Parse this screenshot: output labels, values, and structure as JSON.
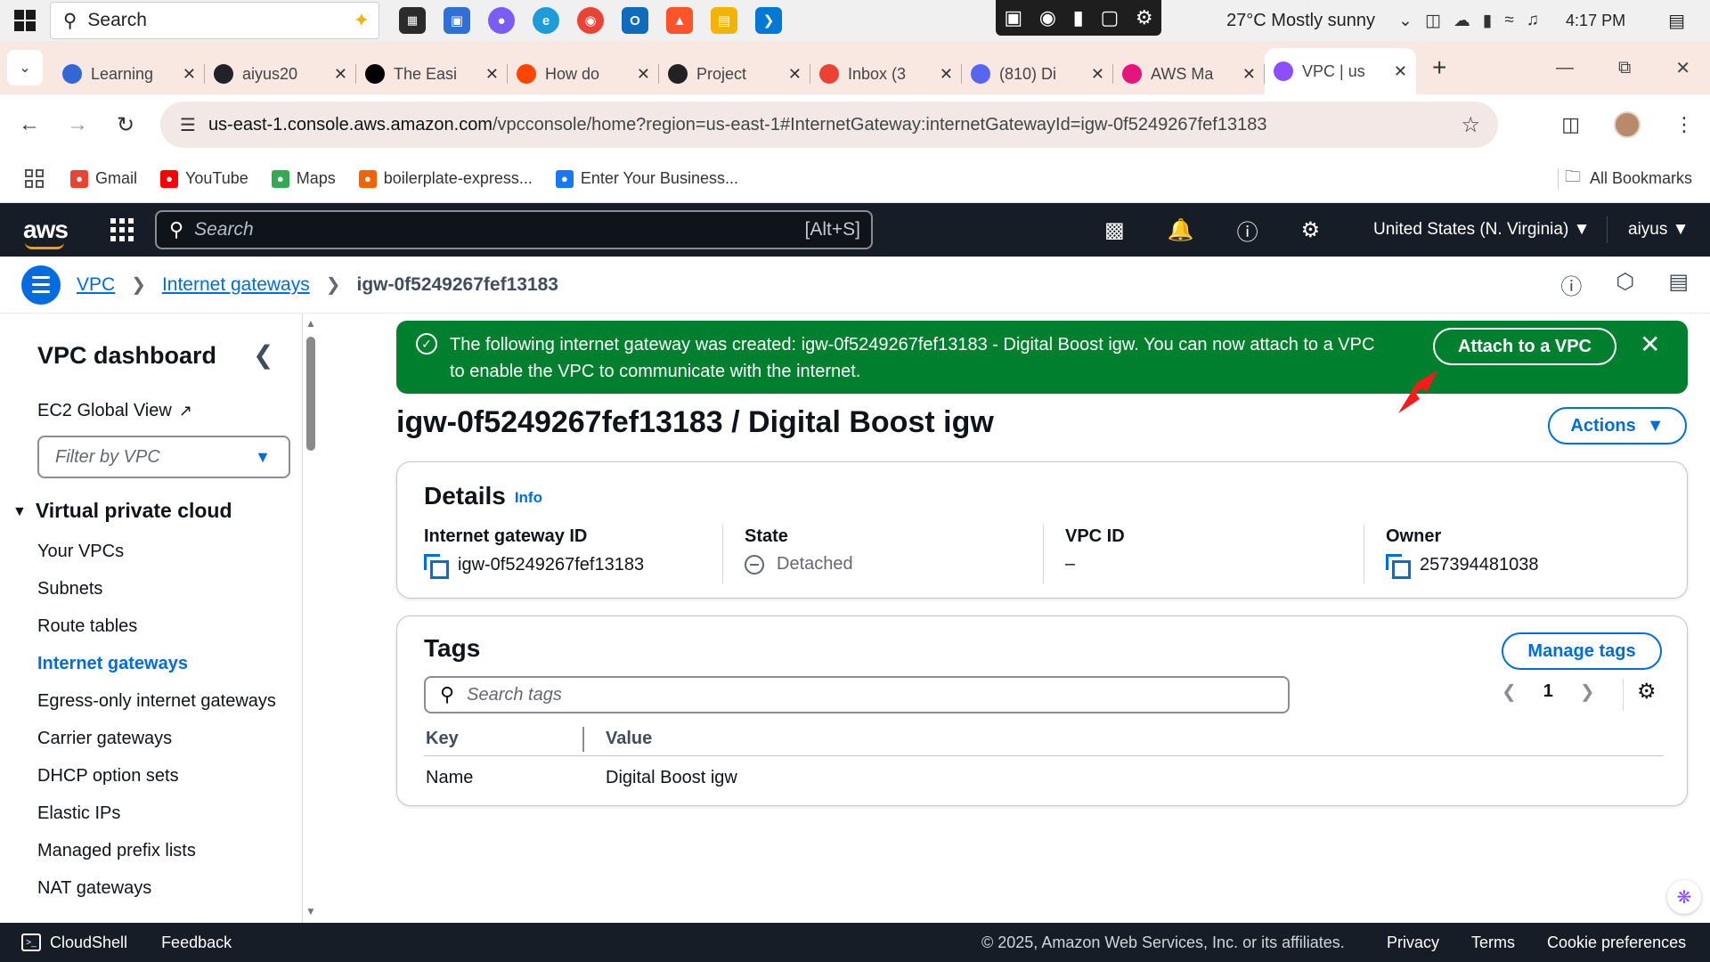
{
  "taskbar": {
    "search_placeholder": "Search",
    "weather": "27°C  Mostly sunny",
    "time": "4:17 PM"
  },
  "tabs": [
    {
      "label": "Learning",
      "icon": "learning-icon",
      "color": "#3367d6"
    },
    {
      "label": "aiyus20",
      "icon": "github-icon",
      "color": "#1f2328"
    },
    {
      "label": "The Easi",
      "icon": "medium-icon",
      "color": "#000000"
    },
    {
      "label": "How do",
      "icon": "reddit-icon",
      "color": "#ff4500"
    },
    {
      "label": "Project",
      "icon": "openai-icon",
      "color": "#222222"
    },
    {
      "label": "Inbox (3",
      "icon": "gmail-icon",
      "color": "#ea4335"
    },
    {
      "label": "(810) Di",
      "icon": "discord-icon",
      "color": "#5865f2"
    },
    {
      "label": "AWS Ma",
      "icon": "aws-cube-icon",
      "color": "#e7157b"
    },
    {
      "label": "VPC | us",
      "icon": "vpc-icon",
      "color": "#8c4fff",
      "active": true
    }
  ],
  "address": {
    "host": "us-east-1.console.aws.amazon.com",
    "path": "/vpcconsole/home?region=us-east-1#InternetGateway:internetGatewayId=igw-0f5249267fef13183"
  },
  "bookmarks": [
    {
      "label": "Gmail",
      "icon": "gmail-icon",
      "color": "#ea4335"
    },
    {
      "label": "YouTube",
      "icon": "youtube-icon",
      "color": "#ff0000"
    },
    {
      "label": "Maps",
      "icon": "maps-icon",
      "color": "#34a853"
    },
    {
      "label": "boilerplate-express...",
      "icon": "replit-icon",
      "color": "#f26207"
    },
    {
      "label": "Enter Your Business...",
      "icon": "butterfly-icon",
      "color": "#1877f2"
    }
  ],
  "bookmarks_all": "All Bookmarks",
  "aws": {
    "search_placeholder": "Search",
    "search_shortcut": "[Alt+S]",
    "region": "United States (N. Virginia) ▼",
    "user": "aiyus ▼"
  },
  "breadcrumb": {
    "vpc": "VPC",
    "igws": "Internet gateways",
    "current": "igw-0f5249267fef13183"
  },
  "sidebar": {
    "title": "VPC dashboard",
    "ec2_global": "EC2 Global View",
    "filter_placeholder": "Filter by VPC",
    "section": "Virtual private cloud",
    "items": [
      {
        "label": "Your VPCs"
      },
      {
        "label": "Subnets"
      },
      {
        "label": "Route tables"
      },
      {
        "label": "Internet gateways",
        "active": true
      },
      {
        "label": "Egress-only internet gateways"
      },
      {
        "label": "Carrier gateways"
      },
      {
        "label": "DHCP option sets"
      },
      {
        "label": "Elastic IPs"
      },
      {
        "label": "Managed prefix lists"
      },
      {
        "label": "NAT gateways"
      }
    ]
  },
  "flash": {
    "message": "The following internet gateway was created: igw-0f5249267fef13183 - Digital Boost igw. You can now attach to a VPC to enable the VPC to communicate with the internet.",
    "button": "Attach to a VPC",
    "color": "#00802f"
  },
  "page": {
    "title": "igw-0f5249267fef13183 / Digital Boost igw",
    "actions": "Actions"
  },
  "details": {
    "heading": "Details",
    "info": "Info",
    "gateway_id_label": "Internet gateway ID",
    "gateway_id": "igw-0f5249267fef13183",
    "state_label": "State",
    "state": "Detached",
    "vpc_id_label": "VPC ID",
    "vpc_id": "–",
    "owner_label": "Owner",
    "owner": "257394481038"
  },
  "tags": {
    "heading": "Tags",
    "manage": "Manage tags",
    "search_placeholder": "Search tags",
    "page": "1",
    "col_key": "Key",
    "col_value": "Value",
    "rows": [
      {
        "key": "Name",
        "value": "Digital Boost igw"
      }
    ]
  },
  "footer": {
    "cloudshell": "CloudShell",
    "feedback": "Feedback",
    "copyright": "© 2025, Amazon Web Services, Inc. or its affiliates.",
    "privacy": "Privacy",
    "terms": "Terms",
    "cookies": "Cookie preferences"
  }
}
